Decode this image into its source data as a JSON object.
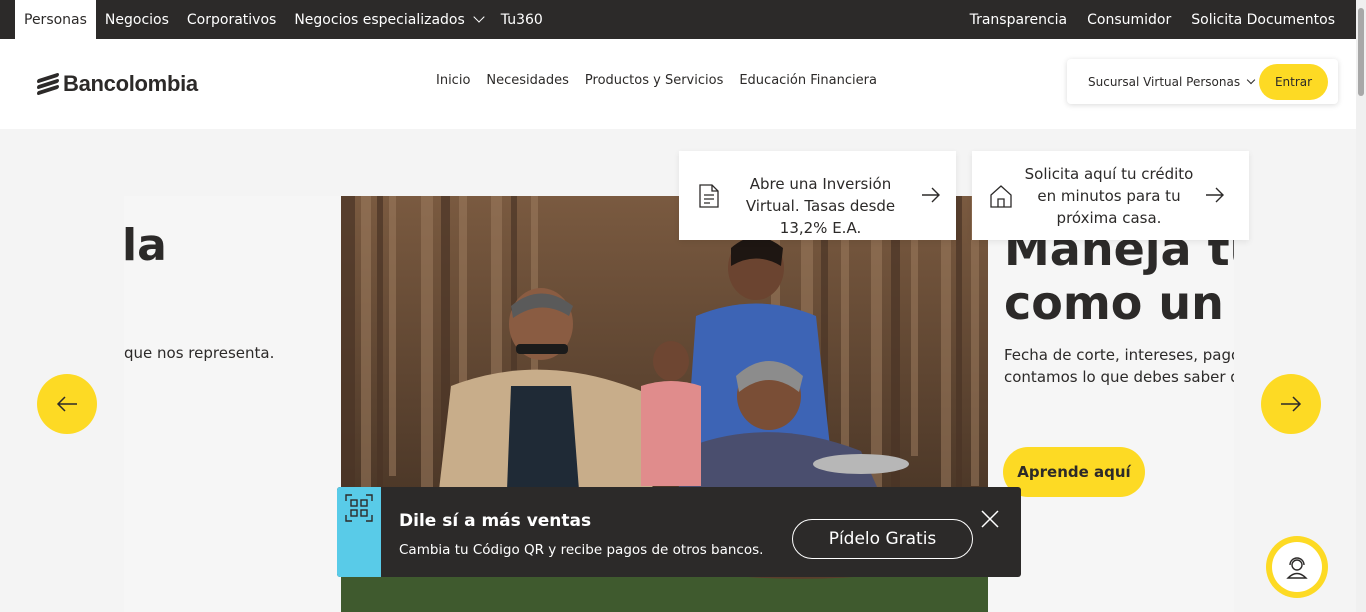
{
  "topbar": {
    "left": [
      "Personas",
      "Negocios",
      "Corporativos",
      "Negocios especializados",
      "Tu360"
    ],
    "right": [
      "Transparencia",
      "Consumidor",
      "Solicita Documentos"
    ]
  },
  "header": {
    "brand": "Bancolombia",
    "nav": [
      "Inicio",
      "Necesidades",
      "Productos y Servicios",
      "Educación Financiera"
    ],
    "sucursal": "Sucursal Virtual Personas",
    "entrar": "Entrar"
  },
  "quick_cards": [
    {
      "text": "Abre una Inversión Virtual. Tasas desde 13,2% E.A.",
      "icon": "document-icon"
    },
    {
      "text": "Solicita aquí tu crédito en minutos para tu próxima casa.",
      "icon": "house-icon"
    }
  ],
  "carousel": {
    "prev_slide": {
      "heading": "la",
      "text": "que nos representa."
    },
    "next_slide": {
      "heading_line1": "Maneja tu",
      "heading_line2": "como un e",
      "text_line1": "Fecha de corte, intereses, pago m",
      "text_line2": "contamos lo que debes saber de",
      "cta": "Aprende aquí"
    }
  },
  "promo": {
    "title": "Dile sí a más ventas",
    "description": "Cambia tu Código QR y recibe pagos de otros bancos.",
    "cta": "Pídelo Gratis"
  },
  "colors": {
    "yellow": "#fdda24",
    "dark": "#2c2a29",
    "promo_accent": "#59cbe8"
  }
}
